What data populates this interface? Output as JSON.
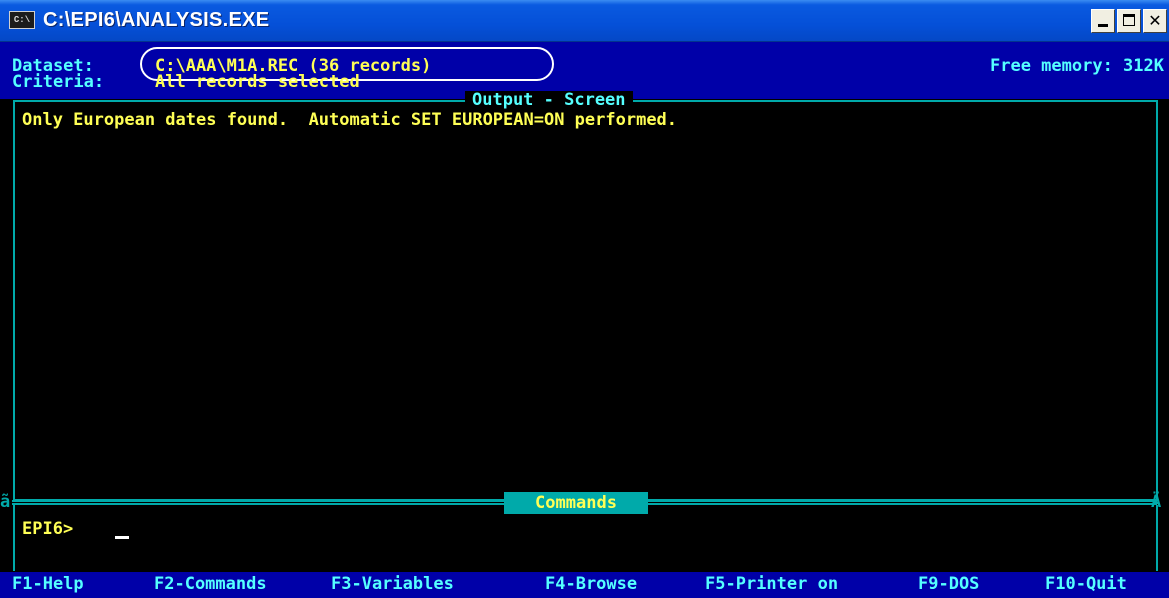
{
  "window": {
    "title": "C:\\EPI6\\ANALYSIS.EXE",
    "icon_name": "console-icon",
    "icon_glyph": "C:\\",
    "minimize_glyph": "",
    "maximize_glyph": "",
    "close_glyph": "✕"
  },
  "status": {
    "dataset_label": "Dataset:",
    "dataset_value": "C:\\AAA\\M1A.REC (36 records)",
    "criteria_label": "Criteria:",
    "criteria_value": "All records selected",
    "free_memory": "Free memory: 312K"
  },
  "output": {
    "title": "Output - Screen",
    "lines": [
      "Only European dates found.  Automatic SET EUROPEAN=ON performed."
    ]
  },
  "commands": {
    "title": "Commands",
    "prompt": "EPI6>",
    "divider_left_glyph": "ã",
    "divider_right_glyph": "Ä"
  },
  "function_keys": [
    "F1-Help",
    "F2-Commands",
    "F3-Variables",
    "F4-Browse",
    "F5-Printer on",
    "F9-DOS",
    "F10-Quit"
  ],
  "colors": {
    "status_background": "#0000a8",
    "label_cyan": "#55ffff",
    "value_yellow": "#ffff55",
    "frame_cyan": "#00aaaa"
  }
}
